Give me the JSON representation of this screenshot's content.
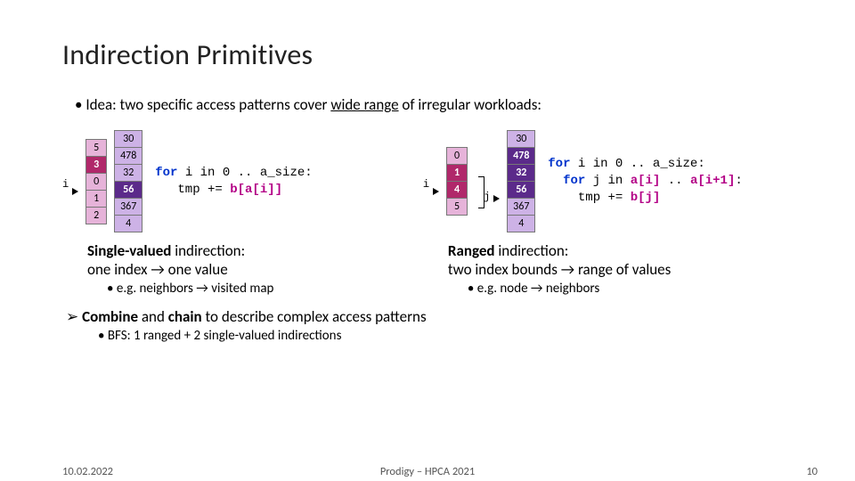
{
  "title": "Indirection Primitives",
  "idea_pre": "Idea: two specific access patterns cover ",
  "idea_u": "wide range",
  "idea_post": " of irregular workloads:",
  "left": {
    "i_label": "i",
    "arr_a": [
      "5",
      "3",
      "0",
      "1",
      "2"
    ],
    "arr_a_hl_index": 1,
    "arr_b": [
      "30",
      "478",
      "32",
      "56",
      "367",
      "4"
    ],
    "arr_b_hl_index": 3,
    "code_line1_pre": "for",
    "code_line1_rest": " i in 0 .. a_size:",
    "code_line2_pre": "   tmp += ",
    "code_line2_ac": "b[a[i]]",
    "desc_b": "Single-valued",
    "desc_rest": " indirection:",
    "desc_line2": "one index → one value",
    "sub": "e.g. neighbors → visited map"
  },
  "right": {
    "i_label": "i",
    "j_label": "j",
    "arr_a": [
      "0",
      "1",
      "4",
      "5"
    ],
    "arr_a_hl_lo": 1,
    "arr_a_hl_hi": 2,
    "arr_b": [
      "30",
      "478",
      "32",
      "56",
      "367",
      "4"
    ],
    "arr_b_hl_lo": 1,
    "arr_b_hl_hi": 3,
    "code_l1_kw": "for",
    "code_l1_rest": " i in 0 .. a_size:",
    "code_l2_kw": "  for",
    "code_l2_mid": " j in ",
    "code_l2_ac1": "a[i]",
    "code_l2_mid2": " .. ",
    "code_l2_ac2": "a[i+1]",
    "code_l2_end": ":",
    "code_l3_pre": "    tmp += ",
    "code_l3_ac": "b[j]",
    "desc_b": "Ranged",
    "desc_rest": " indirection:",
    "desc_line2": "two index bounds → range of values",
    "sub": "e.g. node → neighbors"
  },
  "combine_b1": "Combine",
  "combine_mid": " and ",
  "combine_b2": "chain",
  "combine_rest": " to describe complex access patterns",
  "combine_sub": "BFS: 1 ranged + 2 single-valued indirections",
  "footer": {
    "date": "10.02.2022",
    "center": "Prodigy – HPCA 2021",
    "num": "10"
  }
}
